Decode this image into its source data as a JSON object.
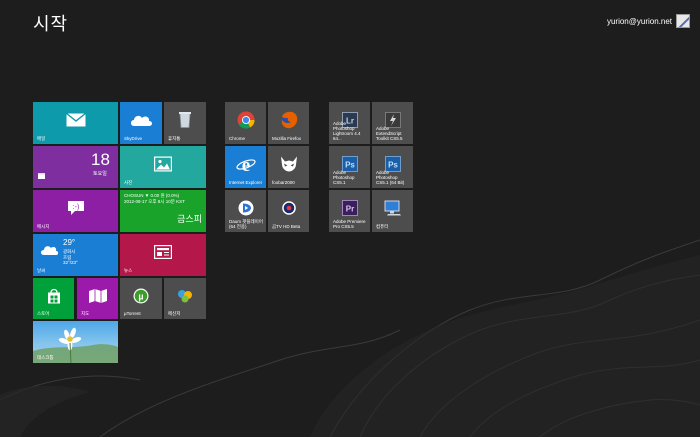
{
  "header": {
    "title": "시작",
    "user_email": "yurion@yurion.net"
  },
  "tiles": {
    "mail": {
      "label": "메일",
      "icon": "mail-icon"
    },
    "skydrive": {
      "label": "SkyDrive",
      "icon": "cloud-icon"
    },
    "recycle": {
      "label": "휴지통",
      "icon": "recycle-bin-icon"
    },
    "calendar": {
      "label": "",
      "date_number": "18",
      "day_name": "토요일",
      "icon": "calendar-icon"
    },
    "photos": {
      "label": "사진",
      "icon": "picture-icon"
    },
    "messaging": {
      "label": "메시지",
      "icon": "smiley-chat-icon"
    },
    "finance": {
      "line1": "CHOSUN ▼ 0.00 원 (0.0%)",
      "line2": "2012-08-17 오후 8시 10분 KST",
      "big": "금스피",
      "label": ""
    },
    "weather": {
      "label": "날씨",
      "temp": "29°",
      "city": "광화시",
      "cond": "흐림",
      "range": "32°/23°"
    },
    "news": {
      "label": "뉴스",
      "icon": "news-icon"
    },
    "store": {
      "label": "스토어",
      "icon": "store-bag-icon"
    },
    "maps": {
      "label": "지도",
      "icon": "map-icon"
    },
    "utorrent": {
      "label": "µTorrent",
      "icon": "utorrent-icon"
    },
    "messenger": {
      "label": "메신저",
      "icon": "messenger-icon"
    },
    "desktop": {
      "label": "데스크톱",
      "icon": "desktop-photo-icon"
    },
    "chrome": {
      "label": "Chrome",
      "icon": "chrome-icon"
    },
    "firefox": {
      "label": "Mozilla Firefox",
      "icon": "firefox-icon"
    },
    "ie": {
      "label": "Internet Explorer",
      "icon": "internet-explorer-icon"
    },
    "foobar": {
      "label": "foobar2000",
      "icon": "foobar-icon"
    },
    "daum": {
      "label": "Daum 팟플레이어 (64 전용)",
      "icon": "daum-potplayer-icon"
    },
    "gomtv": {
      "label": "곰TV HD Beta",
      "icon": "gomtv-icon"
    },
    "lightroom": {
      "label": "Adobe Photoshop Lightroom 4.4 64...",
      "icon": "lightroom-icon",
      "glyph": "Lr"
    },
    "extendscript": {
      "label": "Adobe ExtendScript Toolkit CS5.5",
      "icon": "extendscript-icon"
    },
    "ps_cs5": {
      "label": "Adobe Photoshop CS5.1",
      "icon": "photoshop-icon",
      "glyph": "Ps"
    },
    "ps_cs5_64": {
      "label": "Adobe Photoshop CS5.1 (64 Bit)",
      "icon": "photoshop-icon",
      "glyph": "Ps"
    },
    "premiere": {
      "label": "Adobe Premiere Pro CS5.5",
      "icon": "premiere-icon",
      "glyph": "Pr"
    },
    "computer": {
      "label": "컴퓨터",
      "icon": "computer-icon"
    }
  },
  "colors": {
    "background": "#1d1d1d",
    "teal": "#0d9aab",
    "blue": "#1a7fd4",
    "purple": "#7e2e9f",
    "green": "#19a32a",
    "red": "#b4174a",
    "gray": "#4d4d4d"
  }
}
